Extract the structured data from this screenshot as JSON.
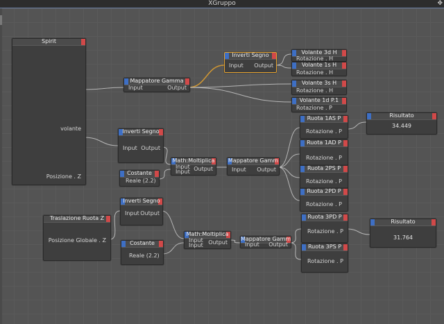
{
  "window": {
    "title": "XGruppo",
    "corner_icon": "move-arrows-icon"
  },
  "nodes": {
    "spirit": {
      "title": "Spirit",
      "port_volante": "volante",
      "port_posz": "Posizione . Z"
    },
    "map1": {
      "title": "Mappatore Gamma",
      "in": "Input",
      "out": "Output"
    },
    "inv1": {
      "title": "Inverti Segno",
      "in": "Input",
      "out": "Output"
    },
    "vol3d": {
      "title": "Volante 3d H",
      "port": "Rotazione . H"
    },
    "vol1s": {
      "title": "Volante 1s H",
      "port": "Rotazione . H"
    },
    "vol3s": {
      "title": "Volante 3s H",
      "port": "Rotazione . H"
    },
    "vol1d": {
      "title": "Volante 1d P.1",
      "port": "Rotazione . P"
    },
    "inv2": {
      "title": "Inverti Segno",
      "in": "Input",
      "out": "Output"
    },
    "cost1": {
      "title": "Costante",
      "port": "Reale (2.2)"
    },
    "math1": {
      "title": "Math:Moltiplica",
      "in1": "Input",
      "in2": "Input",
      "out": "Output"
    },
    "map2": {
      "title": "Mappatore Gamm",
      "in": "Input",
      "out": "Output"
    },
    "r1as": {
      "title": "Ruota 1AS P",
      "port": "Rotazione . P"
    },
    "r1ad": {
      "title": "Ruota 1AD P",
      "port": "Rotazione . P"
    },
    "r2ps": {
      "title": "Ruota 2PS P",
      "port": "Rotazione . P"
    },
    "r2pd": {
      "title": "Ruota 2PD P",
      "port": "Rotazione . P"
    },
    "ris1": {
      "title": "Risultato",
      "value": "34.449"
    },
    "trasl": {
      "title": "Traslazione Ruota Z",
      "port": "Posizione Globale . Z"
    },
    "inv3": {
      "title": "Inverti Segno",
      "in": "Input",
      "out": "Output"
    },
    "cost2": {
      "title": "Costante",
      "port": "Reale (2.2)"
    },
    "math2": {
      "title": "Math:Moltiplica",
      "in1": "Input",
      "in2": "Input",
      "out": "Output"
    },
    "map3": {
      "title": "Mappatore Gamm",
      "in": "Input",
      "out": "Output"
    },
    "r3pd": {
      "title": "Ruota 3PD P",
      "port": "Rotazione . P"
    },
    "r3ps": {
      "title": "Ruota 3PS P",
      "port": "Rotazione . P"
    },
    "ris2": {
      "title": "Risultato",
      "value": "31.764"
    }
  },
  "colors": {
    "input_pin": "#3e6fc4",
    "output_pin": "#d14949",
    "selection": "#e6a32e",
    "wire": "#c9c9c9"
  }
}
